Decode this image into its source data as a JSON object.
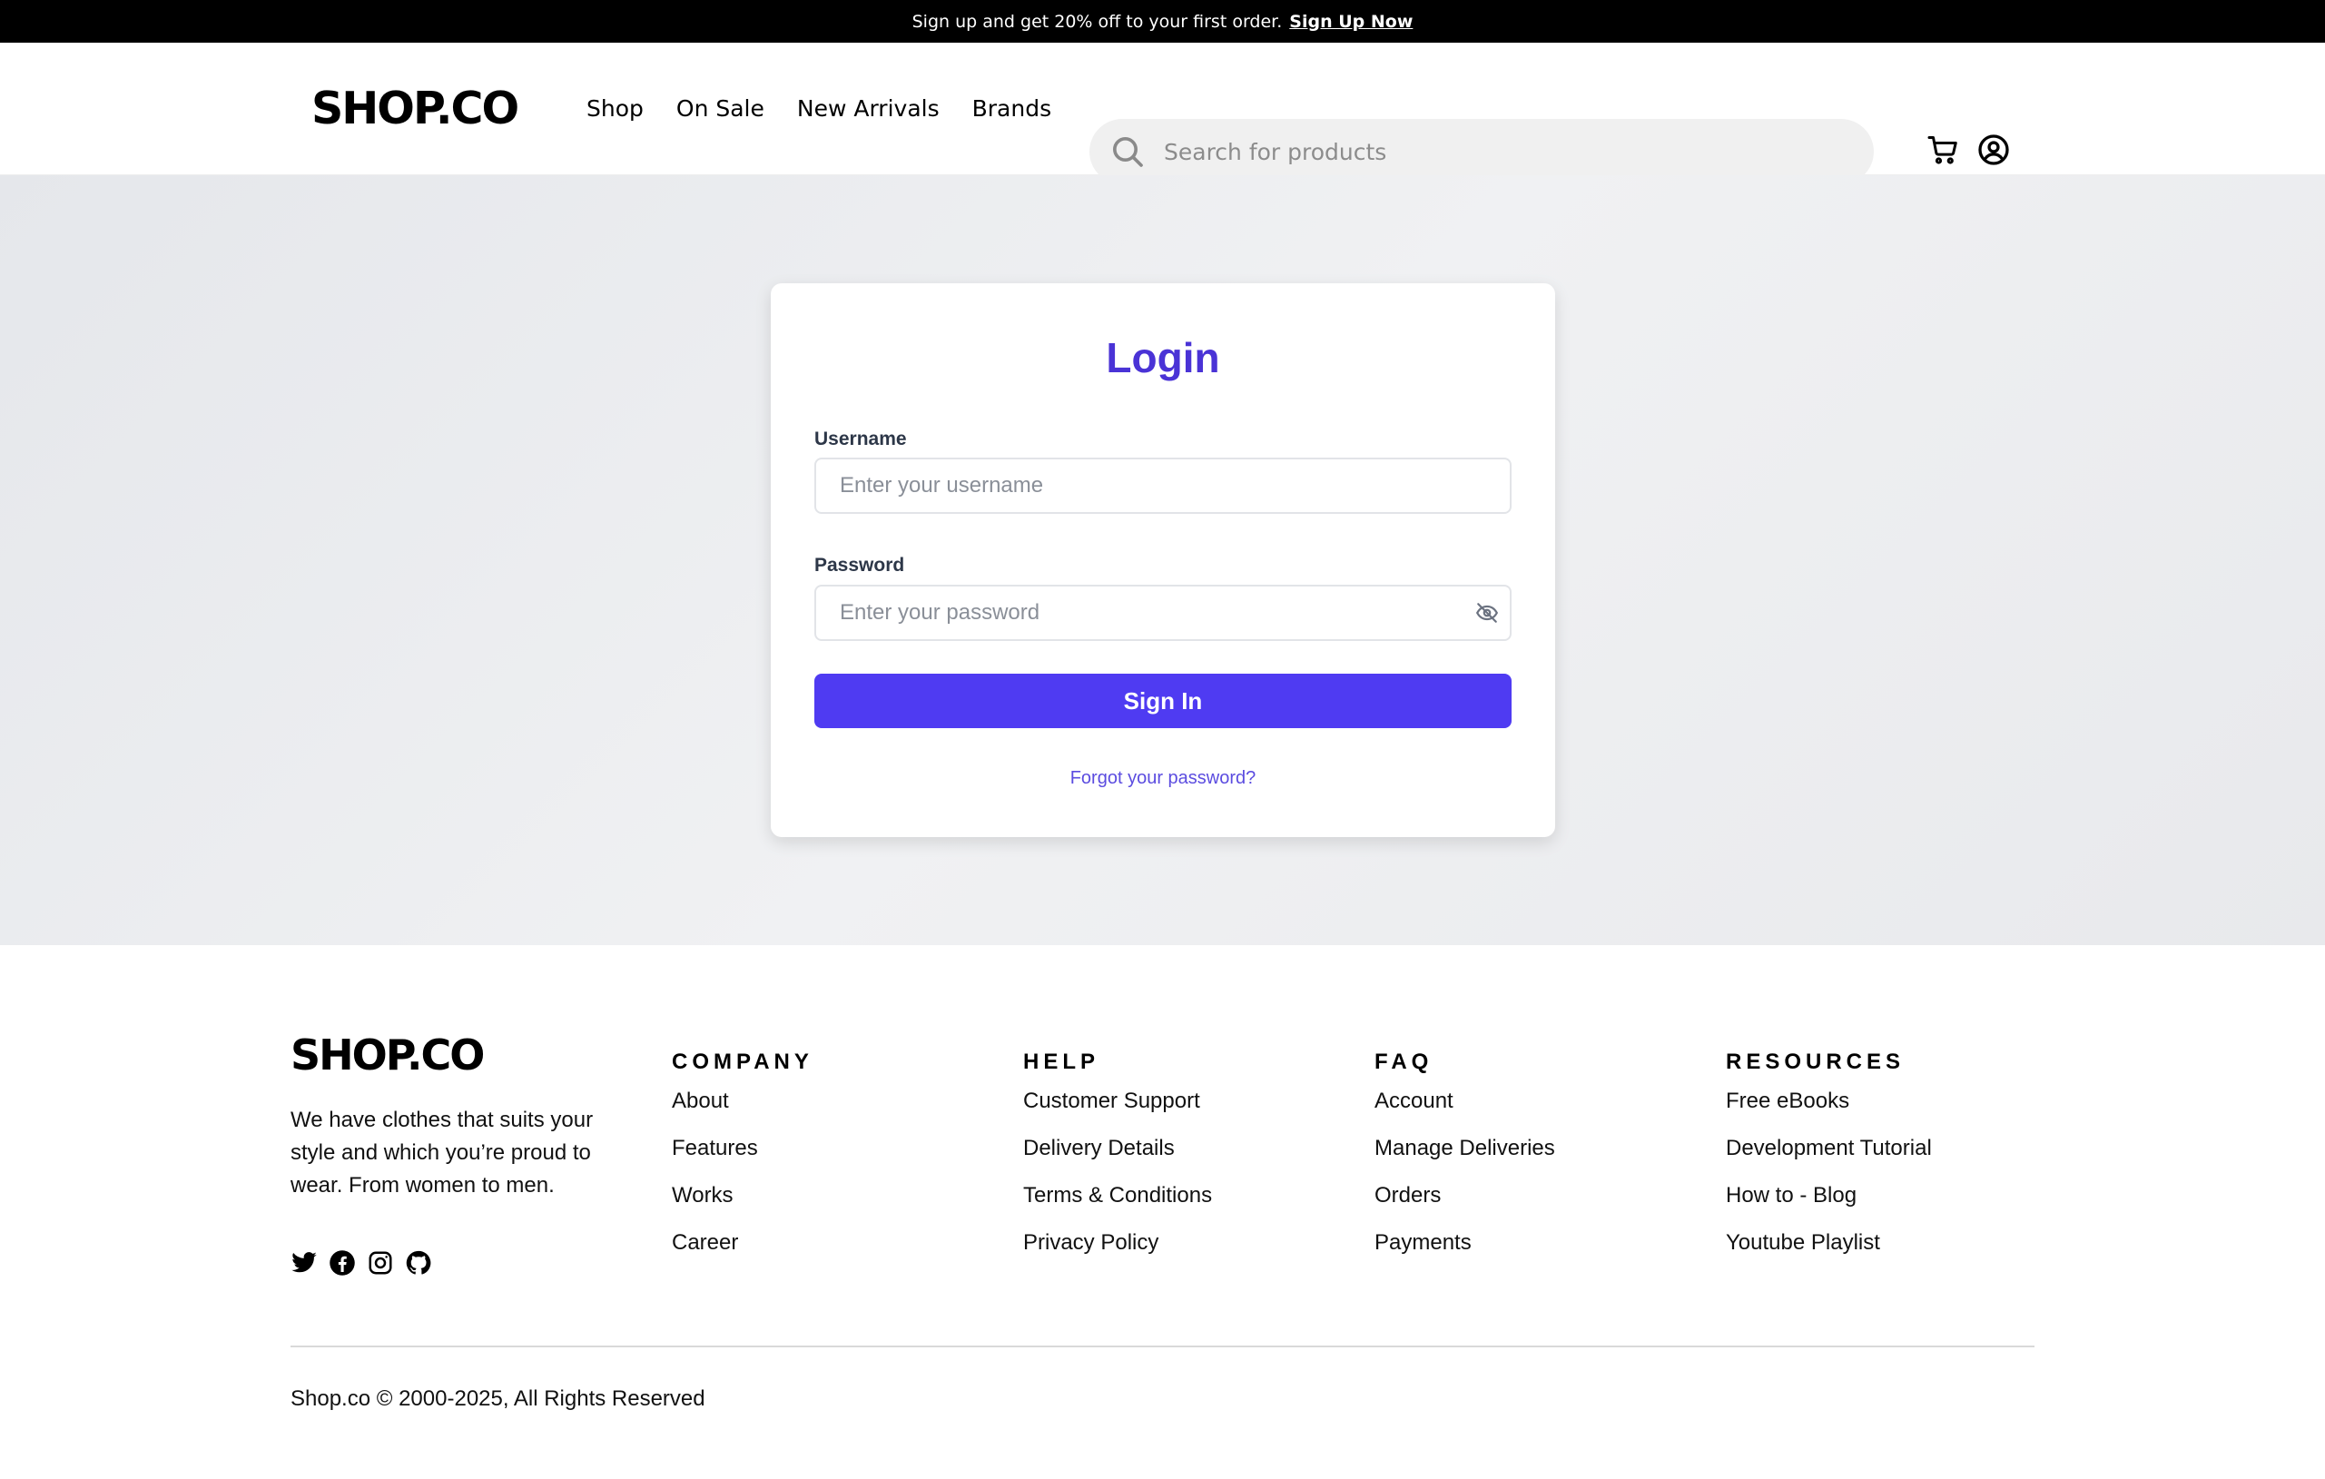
{
  "announcement": {
    "text": "Sign up and get 20% off to your first order.",
    "link": "Sign Up Now"
  },
  "header": {
    "logo": "SHOP.CO",
    "nav": [
      "Shop",
      "On Sale",
      "New Arrivals",
      "Brands"
    ],
    "search_placeholder": "Search for products",
    "icons": [
      "cart-icon",
      "user-icon"
    ]
  },
  "login": {
    "title": "Login",
    "username_label": "Username",
    "username_placeholder": "Enter your username",
    "password_label": "Password",
    "password_placeholder": "Enter your password",
    "submit_label": "Sign In",
    "forgot_label": "Forgot your password?"
  },
  "footer": {
    "logo": "SHOP.CO",
    "description": "We have clothes that suits your style and which you’re proud to wear. From women to men.",
    "social_icons": [
      "twitter-icon",
      "facebook-icon",
      "instagram-icon",
      "github-icon"
    ],
    "columns": [
      {
        "heading": "COMPANY",
        "items": [
          "About",
          "Features",
          "Works",
          "Career"
        ]
      },
      {
        "heading": "HELP",
        "items": [
          "Customer Support",
          "Delivery Details",
          "Terms & Conditions",
          "Privacy Policy"
        ]
      },
      {
        "heading": "FAQ",
        "items": [
          "Account",
          "Manage Deliveries",
          "Orders",
          "Payments"
        ]
      },
      {
        "heading": "RESOURCES",
        "items": [
          "Free eBooks",
          "Development Tutorial",
          "How to - Blog",
          "Youtube Playlist"
        ]
      }
    ],
    "copyright": "Shop.co © 2000-2025, All Rights Reserved"
  },
  "colors": {
    "accent": "#4f3bf2",
    "title": "#4a33d6",
    "link": "#5b4ce0"
  }
}
